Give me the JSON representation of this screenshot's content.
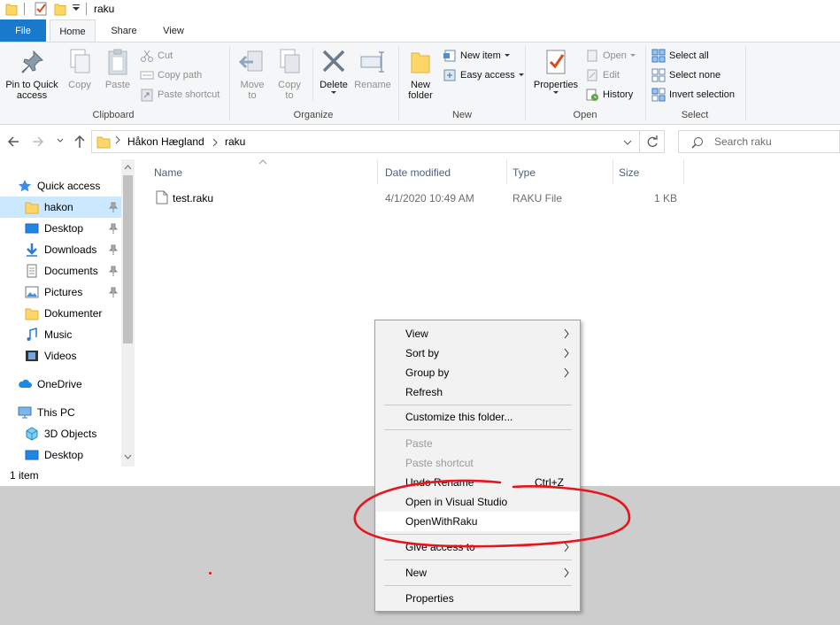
{
  "window": {
    "title": "raku"
  },
  "ribbon_tabs": {
    "file": "File",
    "home": "Home",
    "share": "Share",
    "view": "View"
  },
  "clipboard": {
    "pin": "Pin to Quick\naccess",
    "copy": "Copy",
    "paste": "Paste",
    "cut": "Cut",
    "copy_path": "Copy path",
    "paste_shortcut": "Paste shortcut",
    "label": "Clipboard"
  },
  "organize": {
    "move_to": "Move\nto",
    "copy_to": "Copy\nto",
    "delete": "Delete",
    "rename": "Rename",
    "label": "Organize"
  },
  "new_group": {
    "new_folder": "New\nfolder",
    "new_item": "New item",
    "easy_access": "Easy access",
    "label": "New"
  },
  "open_group": {
    "properties": "Properties",
    "open": "Open",
    "edit": "Edit",
    "history": "History",
    "label": "Open"
  },
  "select_group": {
    "select_all": "Select all",
    "select_none": "Select none",
    "invert": "Invert selection",
    "label": "Select"
  },
  "address": {
    "crumbs": [
      "Håkon Hægland",
      "raku"
    ],
    "search_placeholder": "Search raku"
  },
  "nav": {
    "quick_access": "Quick access",
    "items": [
      {
        "label": "hakon",
        "pinned": true
      },
      {
        "label": "Desktop",
        "pinned": true
      },
      {
        "label": "Downloads",
        "pinned": true
      },
      {
        "label": "Documents",
        "pinned": true
      },
      {
        "label": "Pictures",
        "pinned": true
      },
      {
        "label": "Dokumenter",
        "pinned": false
      },
      {
        "label": "Music",
        "pinned": false
      },
      {
        "label": "Videos",
        "pinned": false
      }
    ],
    "onedrive": "OneDrive",
    "this_pc": "This PC",
    "pc_items": [
      "3D Objects",
      "Desktop"
    ]
  },
  "columns": {
    "name": "Name",
    "date": "Date modified",
    "type": "Type",
    "size": "Size"
  },
  "files": [
    {
      "name": "test.raku",
      "date": "4/1/2020 10:49 AM",
      "type": "RAKU File",
      "size": "1 KB"
    }
  ],
  "status": {
    "count": "1 item"
  },
  "context_menu": {
    "view": "View",
    "sort_by": "Sort by",
    "group_by": "Group by",
    "refresh": "Refresh",
    "customize": "Customize this folder...",
    "paste": "Paste",
    "paste_shortcut": "Paste shortcut",
    "undo_rename": "Undo Rename",
    "undo_shortcut": "Ctrl+Z",
    "open_vs": "Open in Visual Studio",
    "open_raku": "OpenWithRaku",
    "give_access": "Give access to",
    "new": "New",
    "properties": "Properties"
  },
  "colors": {
    "accent": "#1979ca",
    "selection": "#cce8ff",
    "annotation": "#e8141b",
    "folder": "#ffd766"
  }
}
